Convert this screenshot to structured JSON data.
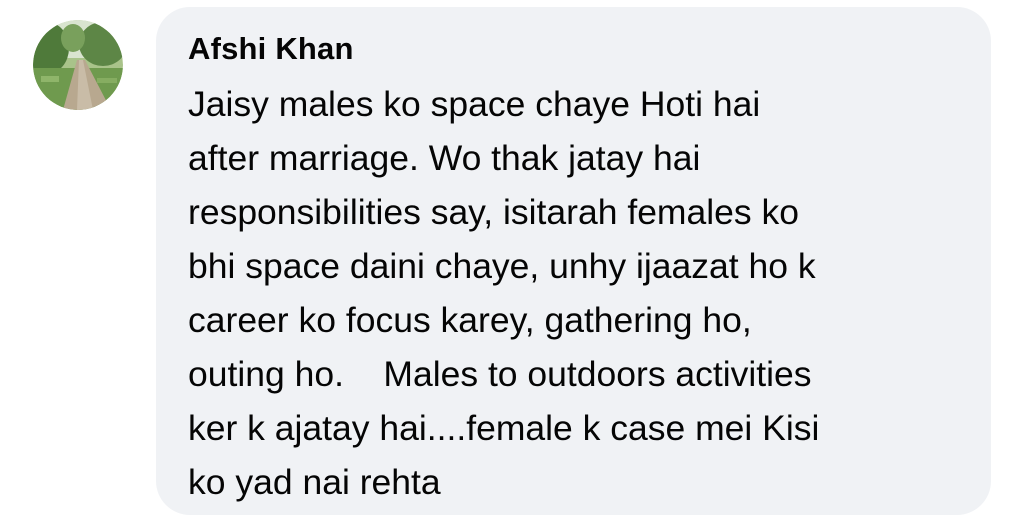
{
  "comment": {
    "author": "Afshi Khan",
    "avatar_icon": "profile-photo-park-path",
    "text": "Jaisy males ko space chaye Hoti hai\nafter marriage. Wo thak jatay hai\nresponsibilities say, isitarah females ko\nbhi space daini chaye, unhy ijaazat ho k\ncareer ko focus karey, gathering ho,\nouting ho.    Males to outdoors activities\nker k ajatay hai....female k case mei Kisi\nko yad nai rehta",
    "bubble_color": "#f0f2f5",
    "text_color": "#050505"
  }
}
